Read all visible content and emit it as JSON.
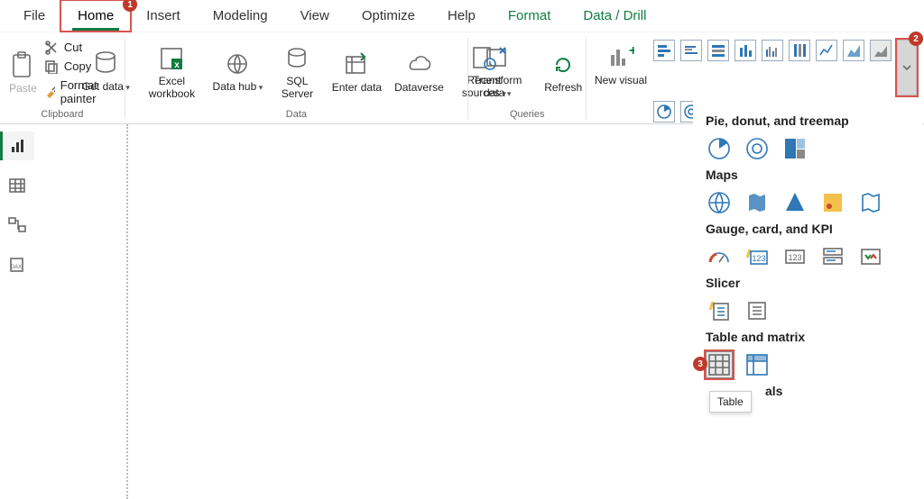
{
  "menu": {
    "file": "File",
    "home": "Home",
    "insert": "Insert",
    "modeling": "Modeling",
    "view": "View",
    "optimize": "Optimize",
    "help": "Help",
    "format": "Format",
    "data_drill": "Data / Drill"
  },
  "ribbon": {
    "paste": "Paste",
    "cut": "Cut",
    "copy": "Copy",
    "format_painter": "Format painter",
    "clipboard_group": "Clipboard",
    "get_data": "Get data",
    "excel_workbook": "Excel workbook",
    "data_hub": "Data hub",
    "sql_server": "SQL Server",
    "enter_data": "Enter data",
    "dataverse": "Dataverse",
    "recent_sources": "Recent sources",
    "data_group": "Data",
    "transform_data": "Transform data",
    "refresh": "Refresh",
    "queries_group": "Queries",
    "new_visual": "New visual"
  },
  "flyout": {
    "pie_section": "Pie, donut, and treemap",
    "maps_section": "Maps",
    "gauge_section": "Gauge, card, and KPI",
    "slicer_section": "Slicer",
    "table_section": "Table and matrix",
    "visuals_partial": "als",
    "table_tooltip": "Table"
  },
  "callouts": {
    "one": "1",
    "two": "2",
    "three": "3"
  }
}
